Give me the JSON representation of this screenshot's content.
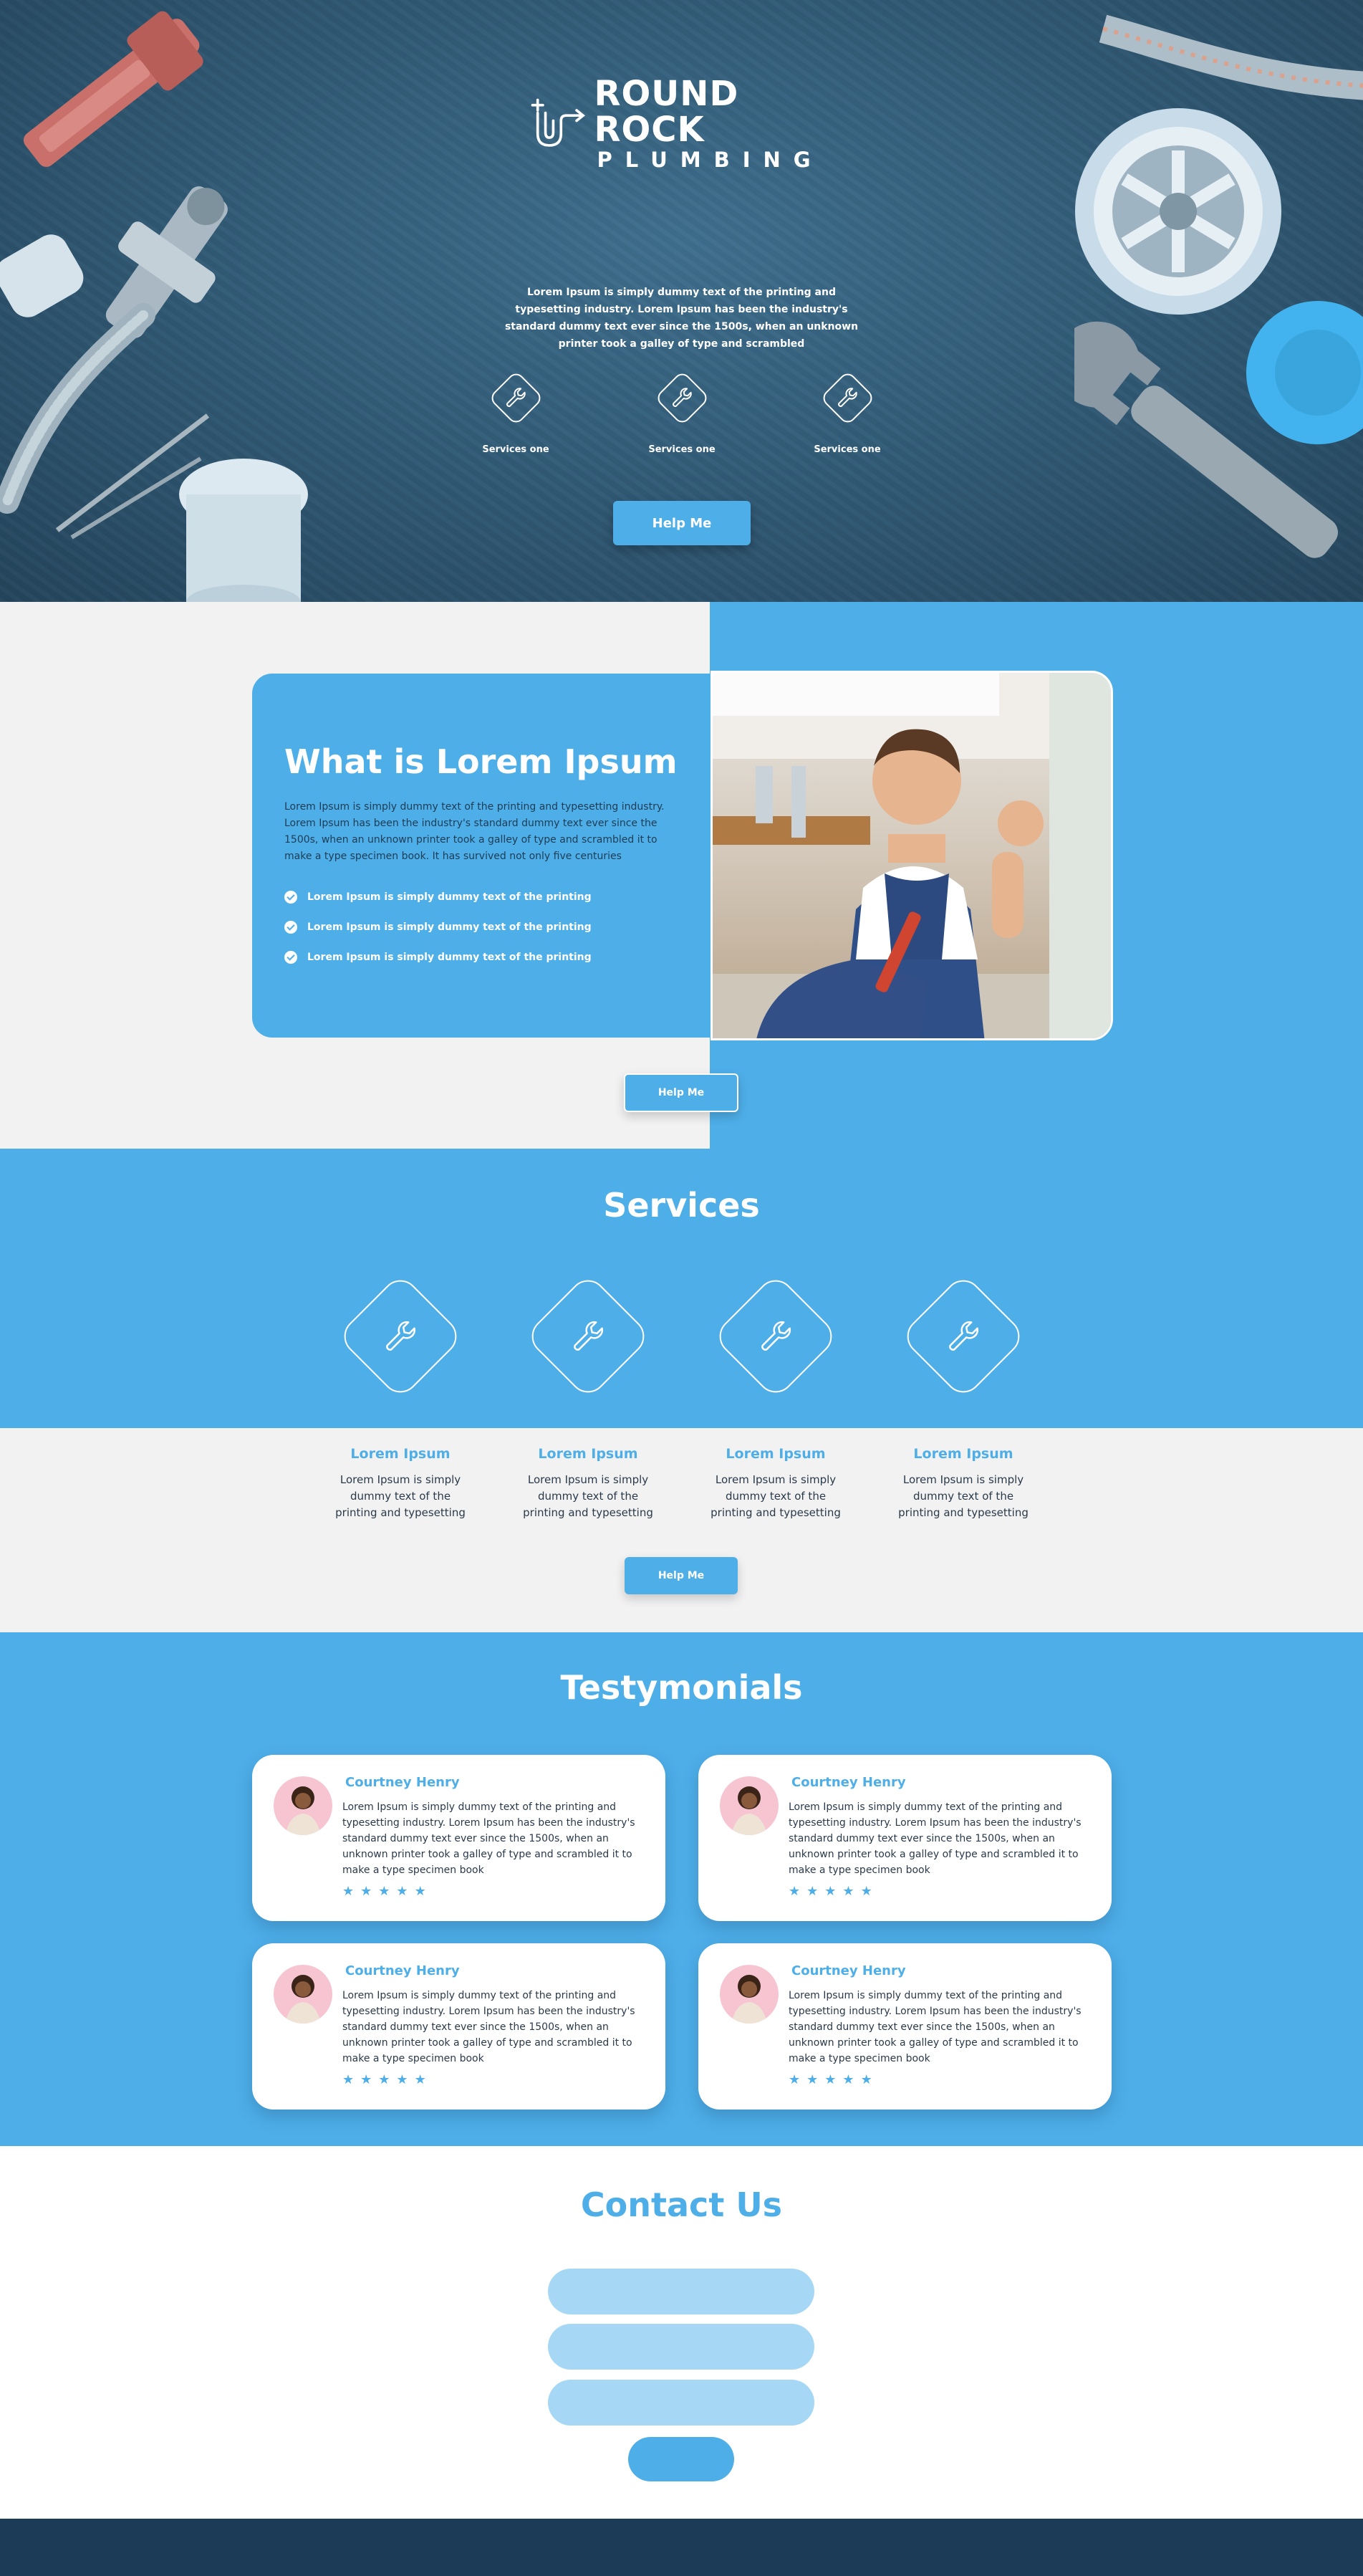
{
  "brand": {
    "name_line1": "ROUND ROCK",
    "name_line2": "PLUMBING"
  },
  "hero": {
    "text": "Lorem Ipsum is simply dummy text of the printing and typesetting industry. Lorem Ipsum has been the industry's standard dummy text ever since the 1500s, when an unknown printer took a galley of type and scrambled",
    "services": [
      {
        "label": "Services one",
        "icon": "wrench-icon"
      },
      {
        "label": "Services one",
        "icon": "wrench-icon"
      },
      {
        "label": "Services one",
        "icon": "wrench-icon"
      }
    ],
    "button_label": "Help Me"
  },
  "about": {
    "title": "What is Lorem Ipsum",
    "body": "Lorem Ipsum is simply dummy text of the printing and typesetting industry. Lorem Ipsum has been the industry's standard dummy text ever since the 1500s, when an unknown printer took a galley of type and scrambled it to make a type specimen book. It has survived not only five centuries",
    "list": [
      "Lorem Ipsum is simply dummy text of the printing",
      "Lorem Ipsum is simply dummy text of the printing",
      "Lorem Ipsum is simply dummy text of the printing"
    ],
    "button_label": "Help Me"
  },
  "services": {
    "title": "Services",
    "items": [
      {
        "title": "Lorem Ipsum",
        "desc": "Lorem Ipsum is simply dummy text of the printing and typesetting",
        "icon": "wrench-icon"
      },
      {
        "title": "Lorem Ipsum",
        "desc": "Lorem Ipsum is simply dummy text of the printing and typesetting",
        "icon": "wrench-icon"
      },
      {
        "title": "Lorem Ipsum",
        "desc": "Lorem Ipsum is simply dummy text of the printing and typesetting",
        "icon": "wrench-icon"
      },
      {
        "title": "Lorem Ipsum",
        "desc": "Lorem Ipsum is simply dummy text of the printing and typesetting",
        "icon": "wrench-icon"
      }
    ],
    "button_label": "Help Me"
  },
  "testimonials": {
    "title": "Testymonials",
    "items": [
      {
        "name": "Courtney Henry",
        "text": "Lorem Ipsum is simply dummy text of the printing and typesetting industry. Lorem Ipsum has been the industry's standard dummy text ever since the 1500s, when an unknown printer took a galley of type and scrambled it to make a type specimen book",
        "stars": 5
      },
      {
        "name": "Courtney Henry",
        "text": "Lorem Ipsum is simply dummy text of the printing and typesetting industry. Lorem Ipsum has been the industry's standard dummy text ever since the 1500s, when an unknown printer took a galley of type and scrambled it to make a type specimen book",
        "stars": 5
      },
      {
        "name": "Courtney Henry",
        "text": "Lorem Ipsum is simply dummy text of the printing and typesetting industry. Lorem Ipsum has been the industry's standard dummy text ever since the 1500s, when an unknown printer took a galley of type and scrambled it to make a type specimen book",
        "stars": 5
      },
      {
        "name": "Courtney Henry",
        "text": "Lorem Ipsum is simply dummy text of the printing and typesetting industry. Lorem Ipsum has been the industry's standard dummy text ever since the 1500s, when an unknown printer took a galley of type and scrambled it to make a type specimen book",
        "stars": 5
      }
    ]
  },
  "contact": {
    "title": "Contact Us",
    "fields": [
      {
        "value": "",
        "placeholder": ""
      },
      {
        "value": "",
        "placeholder": ""
      },
      {
        "value": "",
        "placeholder": ""
      }
    ],
    "submit_label": ""
  },
  "colors": {
    "accent": "#4eaee8",
    "hero_bg": "#325c78",
    "light_field": "#a6d8f6",
    "footer": "#1c3b56",
    "section_gray": "#f2f2f2"
  }
}
